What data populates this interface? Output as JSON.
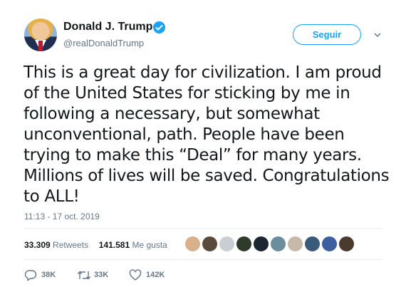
{
  "author": {
    "name": "Donald J. Trump",
    "handle": "@realDonaldTrump",
    "verified": true
  },
  "follow_button": {
    "label": "Seguir"
  },
  "tweet": {
    "lines": [
      "This is a great day for civilization. I am proud",
      "of the United States for sticking by me in",
      "following a necessary, but somewhat",
      "unconventional, path. People have been",
      "trying to make this “Deal” for many years.",
      "Millions of lives will be saved. Congratulations",
      "to ALL!"
    ],
    "timestamp": "11:13 - 17 oct. 2019"
  },
  "stats": {
    "retweets_count": "33.309",
    "retweets_label": "Retweets",
    "likes_count": "141.581",
    "likes_label": "Me gusta"
  },
  "liker_avatars": [
    "#d9b08c",
    "#5a4a3a",
    "#c9ced3",
    "#2f3b2a",
    "#1b2630",
    "#6b8e9e",
    "#c7b9a8",
    "#3a5a7a",
    "#3d5fa0",
    "#4b3b2f"
  ],
  "actions": {
    "replies": "38K",
    "retweets": "33K",
    "likes": "142K"
  },
  "colors": {
    "accent": "#1da1f2",
    "secondary_text": "#657786",
    "divider": "#e6ecf0"
  }
}
